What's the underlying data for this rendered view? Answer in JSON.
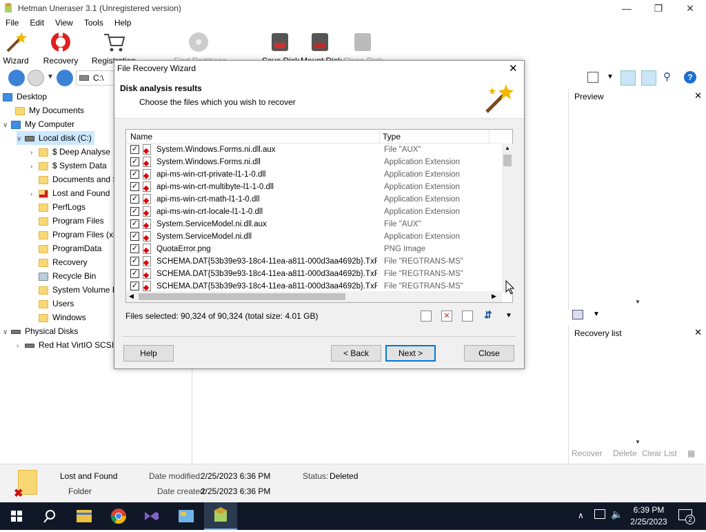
{
  "app": {
    "title": "Hetman Uneraser 3.1 (Unregistered version)"
  },
  "menu": [
    "File",
    "Edit",
    "View",
    "Tools",
    "Help"
  ],
  "toolbar": {
    "wizard": "Wizard",
    "recovery": "Recovery",
    "registration": "Registration",
    "find_partitions": "Find Partitions",
    "save_disk": "Save Disk",
    "mount_disk": "Mount Disk",
    "close_disk": "Close Disk"
  },
  "address": "C:\\",
  "tree": {
    "desktop": "Desktop",
    "my_documents": "My Documents",
    "my_computer": "My Computer",
    "local_disk": "Local disk (C:)",
    "folders": [
      "$ Deep Analyse",
      "$ System Data",
      "Documents and Se",
      "Lost and Found",
      "PerfLogs",
      "Program Files",
      "Program Files (x86",
      "ProgramData",
      "Recovery",
      "Recycle Bin",
      "System Volume In",
      "Users",
      "Windows"
    ],
    "physical_disks": "Physical Disks",
    "red_hat": "Red Hat VirtIO SCSI D"
  },
  "panels": {
    "preview": "Preview",
    "recovery_list": "Recovery list",
    "recover": "Recover",
    "delete": "Delete",
    "clear_list": "Clear List"
  },
  "dialog": {
    "title": "File Recovery Wizard",
    "heading": "Disk analysis results",
    "subheading": "Choose the files which you wish to recover",
    "col_name": "Name",
    "col_type": "Type",
    "files": [
      {
        "name": "System.Windows.Forms.ni.dll.aux",
        "type": "File \"AUX\""
      },
      {
        "name": "System.Windows.Forms.ni.dll",
        "type": "Application Extension"
      },
      {
        "name": "api-ms-win-crt-private-l1-1-0.dll",
        "type": "Application Extension"
      },
      {
        "name": "api-ms-win-crt-multibyte-l1-1-0.dll",
        "type": "Application Extension"
      },
      {
        "name": "api-ms-win-crt-math-l1-1-0.dll",
        "type": "Application Extension"
      },
      {
        "name": "api-ms-win-crt-locale-l1-1-0.dll",
        "type": "Application Extension"
      },
      {
        "name": "System.ServiceModel.ni.dll.aux",
        "type": "File \"AUX\""
      },
      {
        "name": "System.ServiceModel.ni.dll",
        "type": "Application Extension"
      },
      {
        "name": "QuotaError.png",
        "type": "PNG Image"
      },
      {
        "name": "SCHEMA.DAT{53b39e93-18c4-11ea-a811-000d3aa4692b}.TxR...",
        "type": "File \"REGTRANS-MS\""
      },
      {
        "name": "SCHEMA.DAT{53b39e93-18c4-11ea-a811-000d3aa4692b}.TxR...",
        "type": "File \"REGTRANS-MS\""
      },
      {
        "name": "SCHEMA.DAT{53b39e93-18c4-11ea-a811-000d3aa4692b}.TxR...",
        "type": "File \"REGTRANS-MS\""
      }
    ],
    "files_selected": "Files selected: 90,324 of 90,324 (total size: 4.01 GB)",
    "help": "Help",
    "back": "< Back",
    "next": "Next >",
    "close": "Close"
  },
  "status": {
    "name": "Lost and Found",
    "kind": "Folder",
    "date_modified_label": "Date modified:",
    "date_modified": "2/25/2023 6:36 PM",
    "date_created_label": "Date created:",
    "date_created": "2/25/2023 6:36 PM",
    "status_label": "Status:",
    "status": "Deleted"
  },
  "taskbar": {
    "time": "6:39 PM",
    "date": "2/25/2023",
    "notifications": "2"
  }
}
